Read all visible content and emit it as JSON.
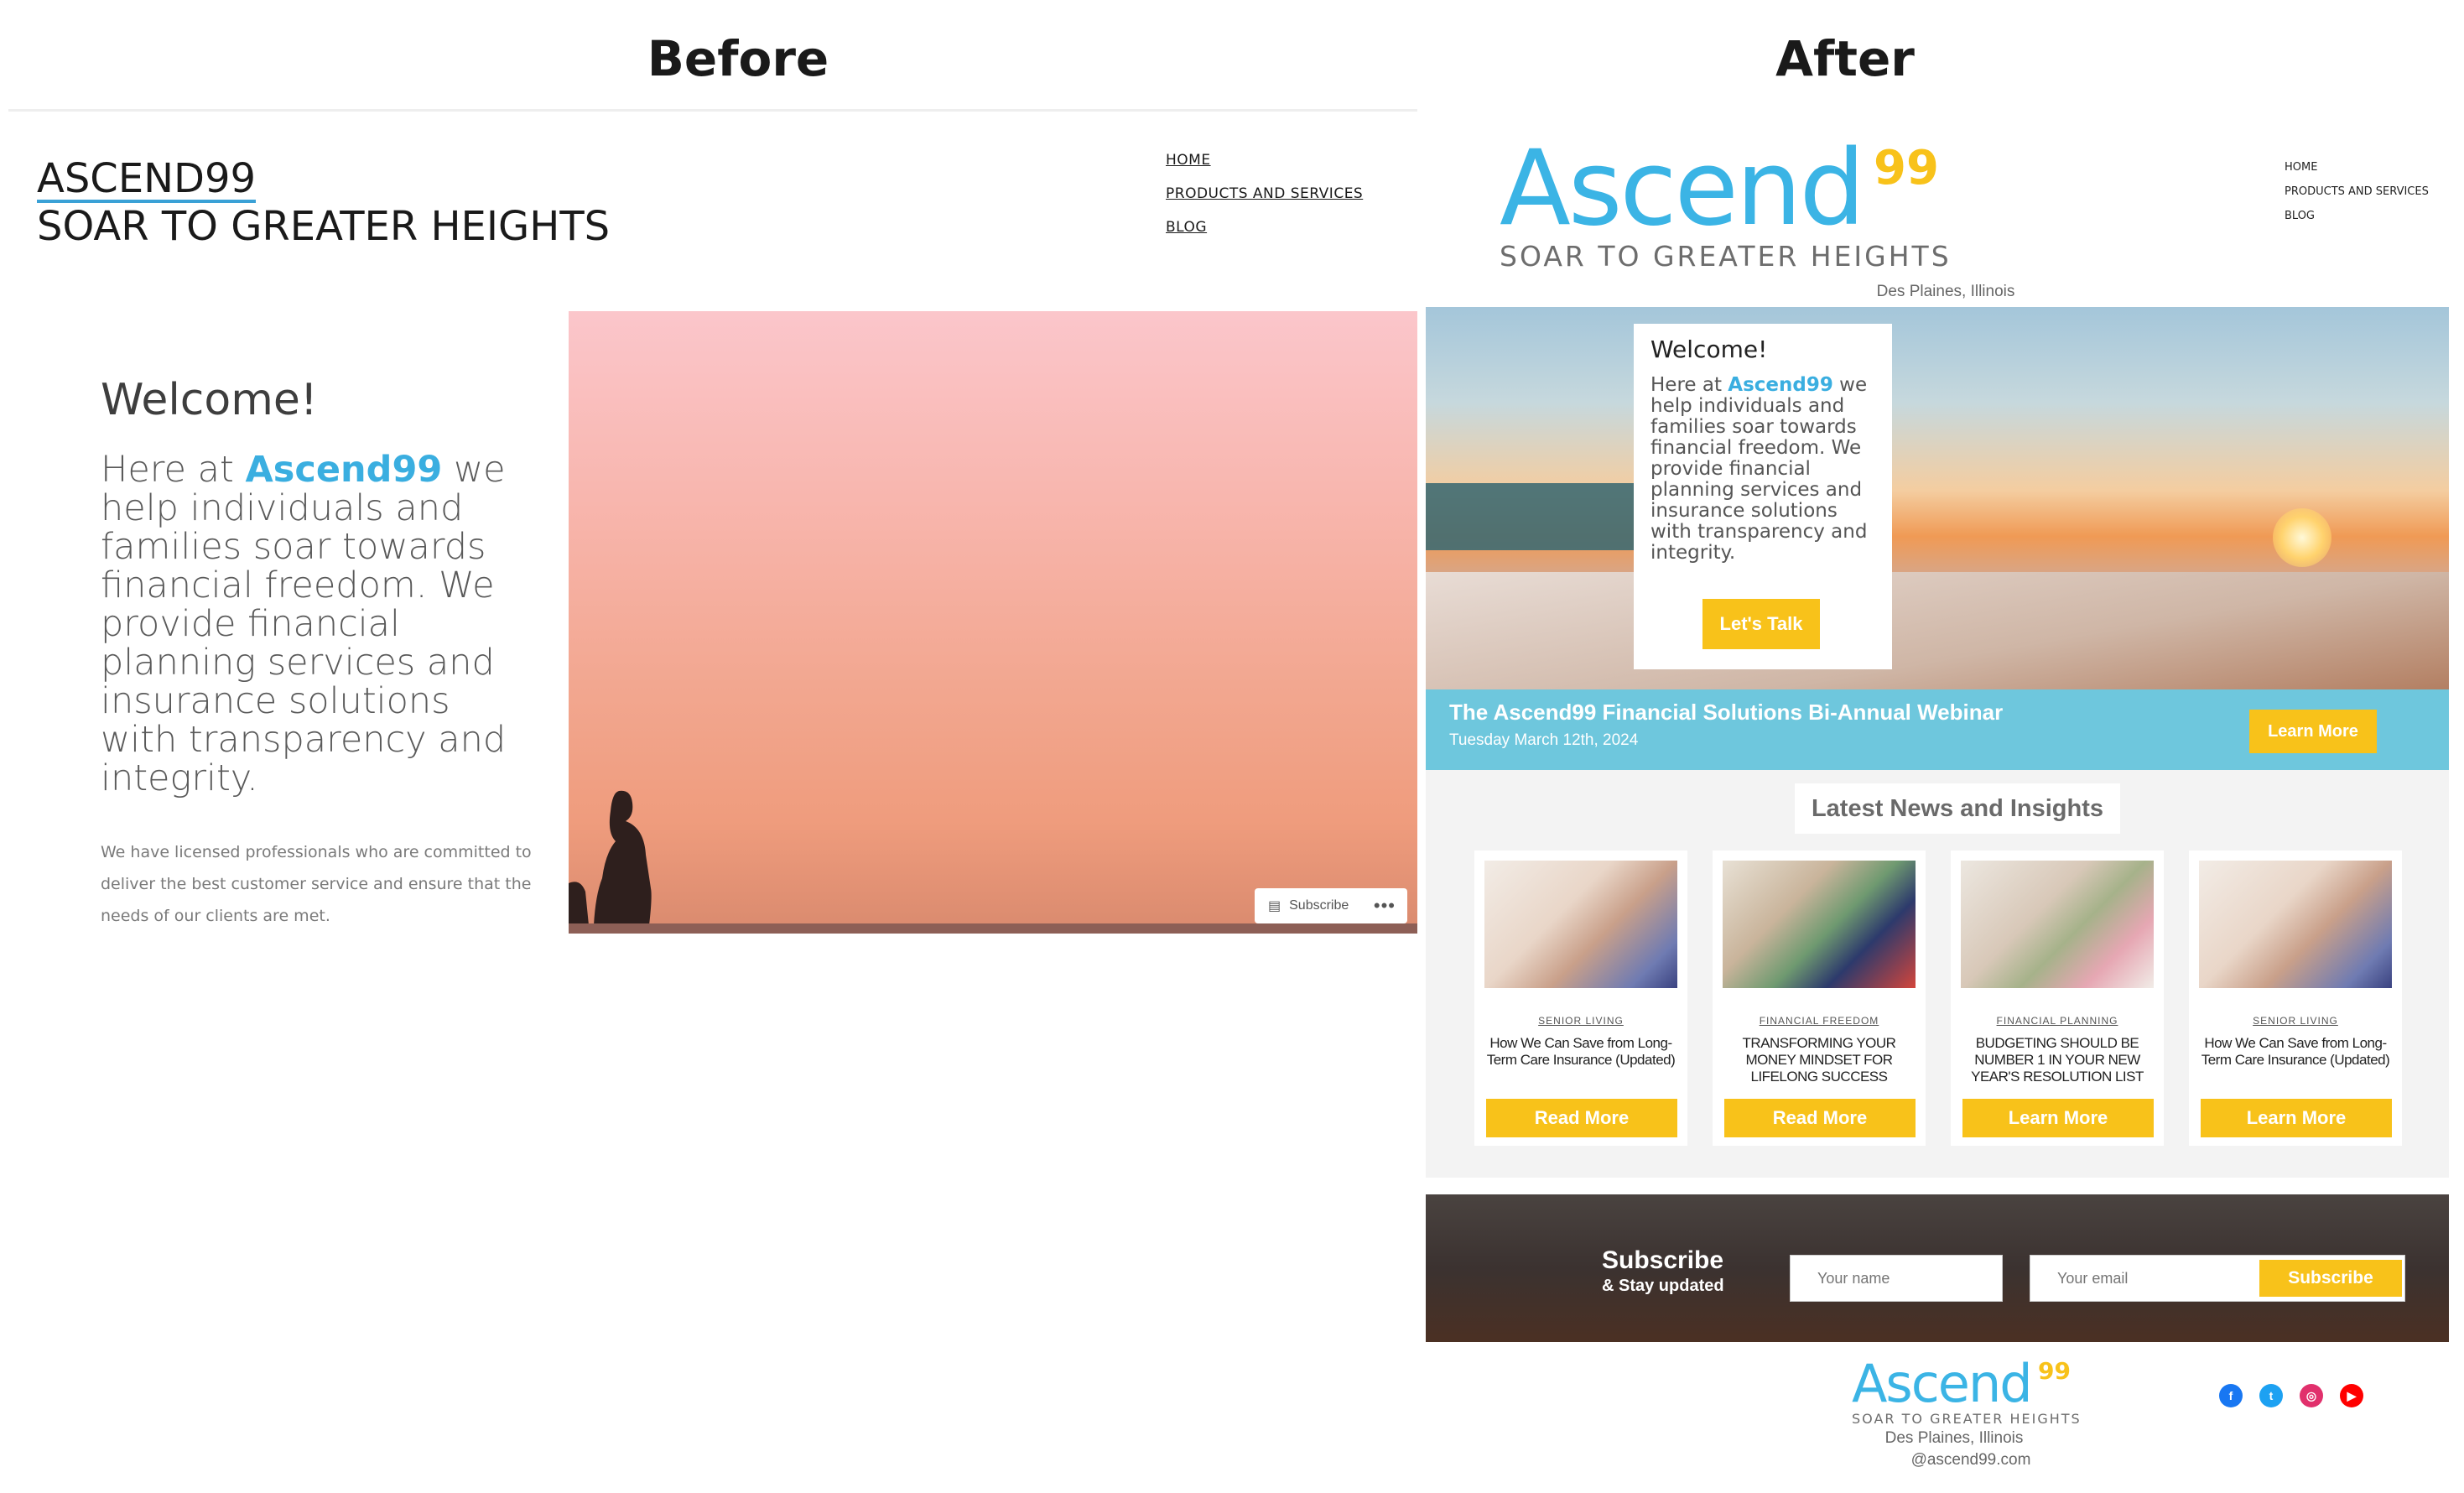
{
  "headings": {
    "before": "Before",
    "after": "After"
  },
  "before": {
    "site_title_line1": "ASCEND99",
    "site_title_line2": "SOAR TO GREATER HEIGHTS",
    "nav": [
      "HOME",
      "PRODUCTS AND SERVICES",
      "BLOG"
    ],
    "welcome": "Welcome!",
    "intro_prefix": "Here at ",
    "intro_brand": "Ascend99",
    "intro_rest": " we help individuals and families soar towards financial freedom. We provide financial planning services and insurance solutions with transparency and integrity.",
    "small_text": "We have licensed professionals who are committed to deliver the best customer service and ensure that the needs of our clients are met.",
    "subscribe_label": "Subscribe",
    "more_label": "•••"
  },
  "after": {
    "logo_word": "Ascend",
    "logo_sup": "99",
    "logo_tagline": "SOAR TO GREATER HEIGHTS",
    "nav": [
      "HOME",
      "PRODUCTS AND SERVICES",
      "BLOG"
    ],
    "location": "Des Plaines, Illinois",
    "hero": {
      "welcome": "Welcome!",
      "intro_prefix": "Here at ",
      "intro_brand": "Ascend99",
      "intro_rest": " we help individuals and families soar towards financial freedom. We provide financial planning services and insurance solutions with transparency and integrity.",
      "cta": "Let's Talk"
    },
    "banner": {
      "title": "The Ascend99 Financial Solutions Bi-Annual Webinar",
      "date": "Tuesday March 12th, 2024",
      "cta": "Learn More"
    },
    "news_title": "Latest News and Insights",
    "news": [
      {
        "category": "SENIOR LIVING",
        "title": "How We Can Save from Long-Term Care Insurance (Updated)",
        "button": "Read More",
        "image": "hands-image"
      },
      {
        "category": "FINANCIAL FREEDOM",
        "title": "TRANSFORMING YOUR MONEY MINDSET FOR LIFELONG SUCCESS",
        "button": "Read More",
        "image": "money-image"
      },
      {
        "category": "FINANCIAL PLANNING",
        "title": "BUDGETING SHOULD BE NUMBER 1 IN YOUR NEW YEAR'S RESOLUTION LIST",
        "button": "Learn More",
        "image": "planning-image"
      },
      {
        "category": "SENIOR LIVING",
        "title": "How We Can Save from Long-Term Care Insurance (Updated)",
        "button": "Learn More",
        "image": "hands-image"
      }
    ],
    "subscribe": {
      "title": "Subscribe",
      "subtitle": "& Stay updated",
      "name_placeholder": "Your name",
      "email_placeholder": "Your email",
      "button": "Subscribe"
    },
    "footer": {
      "logo_word": "Ascend",
      "logo_sup": "99",
      "tagline": "SOAR TO GREATER HEIGHTS",
      "location": "Des Plaines, Illinois",
      "handle": "@ascend99.com"
    },
    "social": [
      {
        "name": "facebook-icon",
        "glyph": "f",
        "color": "#1877f2"
      },
      {
        "name": "twitter-icon",
        "glyph": "t",
        "color": "#1da1f2"
      },
      {
        "name": "instagram-icon",
        "glyph": "◎",
        "color": "#e1306c"
      },
      {
        "name": "youtube-icon",
        "glyph": "▶",
        "color": "#ff0000"
      }
    ],
    "colors": {
      "brand_blue": "#3bb4e5",
      "brand_yellow": "#f8c21a",
      "banner_blue": "#6ec7dd"
    }
  }
}
